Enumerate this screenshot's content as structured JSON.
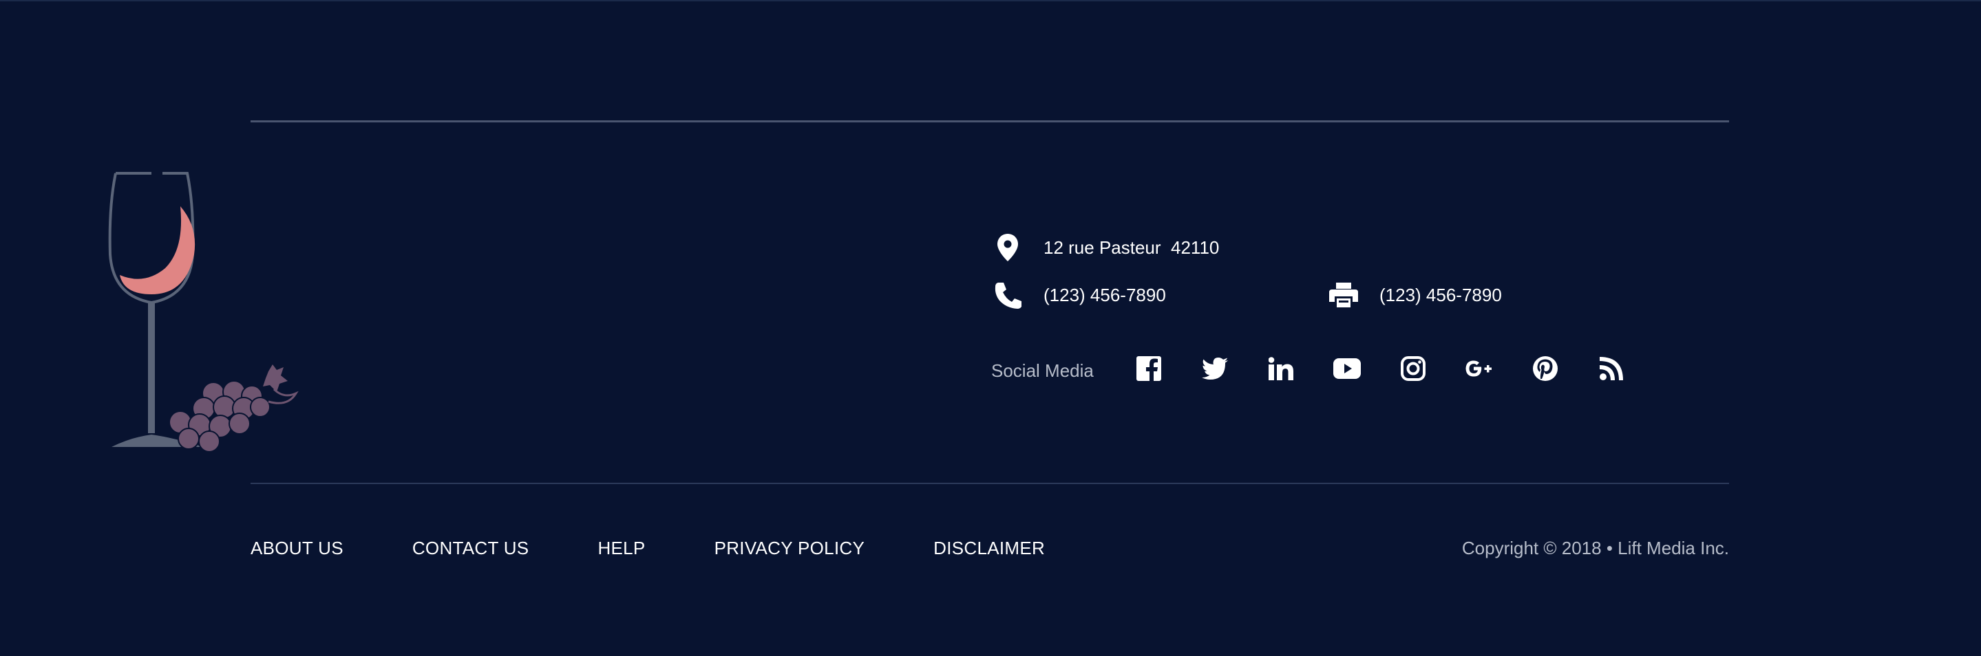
{
  "colors": {
    "background": "#081330",
    "rule": "#4a5570",
    "wine": "#e08584",
    "glass": "#5b6579",
    "grapes": "#6e5570",
    "muted_text": "#b7bdca"
  },
  "logo": {
    "icon": "wine-glass-grapes-icon"
  },
  "contact": {
    "address": "12 rue Pasteur  42110",
    "phone": "(123) 456-7890",
    "fax": "(123) 456-7890",
    "address_icon": "map-pin-icon",
    "phone_icon": "phone-icon",
    "fax_icon": "printer-icon"
  },
  "social": {
    "label": "Social Media",
    "icons": [
      "facebook-icon",
      "twitter-icon",
      "linkedin-icon",
      "youtube-icon",
      "instagram-icon",
      "google-plus-icon",
      "pinterest-icon",
      "rss-icon"
    ]
  },
  "nav": {
    "items": [
      {
        "label": "ABOUT US"
      },
      {
        "label": "CONTACT US"
      },
      {
        "label": "HELP"
      },
      {
        "label": "PRIVACY POLICY"
      },
      {
        "label": "DISCLAIMER"
      }
    ]
  },
  "footer": {
    "copyright": "Copyright © 2018 • Lift Media Inc."
  }
}
